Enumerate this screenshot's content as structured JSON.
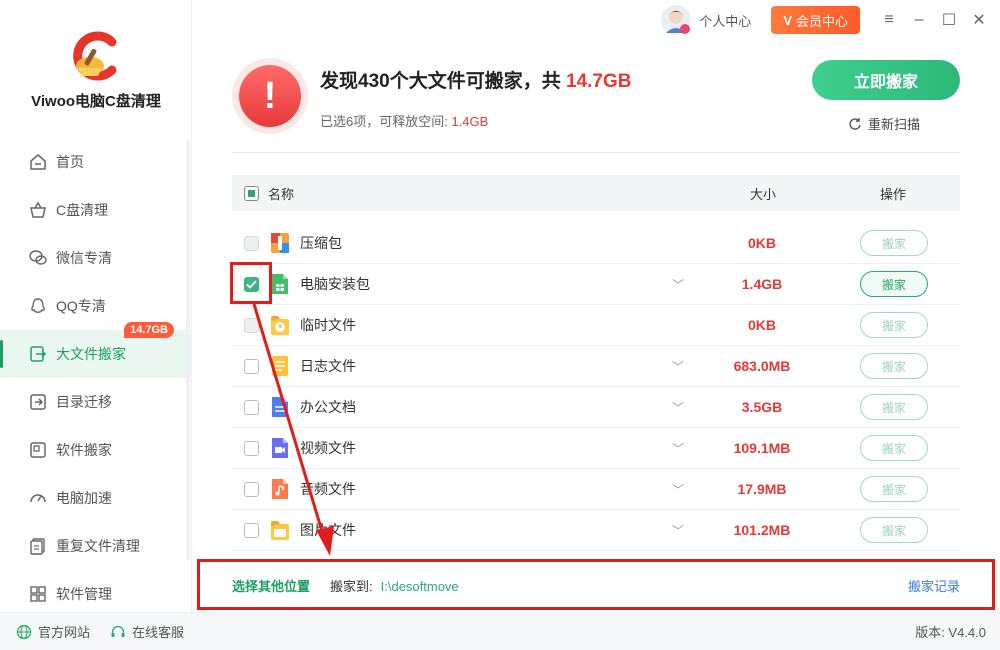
{
  "app": {
    "name": "Viwoo电脑C盘清理"
  },
  "sidebar": {
    "items": [
      {
        "label": "首页",
        "icon": "home-icon",
        "active": false
      },
      {
        "label": "C盘清理",
        "icon": "basket-icon",
        "active": false
      },
      {
        "label": "微信专清",
        "icon": "wechat-icon",
        "active": false
      },
      {
        "label": "QQ专清",
        "icon": "qq-icon",
        "active": false
      },
      {
        "label": "大文件搬家",
        "icon": "move-file-icon",
        "active": true,
        "badge": "14.7GB"
      },
      {
        "label": "目录迁移",
        "icon": "folder-export-icon",
        "active": false
      },
      {
        "label": "软件搬家",
        "icon": "software-move-icon",
        "active": false
      },
      {
        "label": "电脑加速",
        "icon": "speedometer-icon",
        "active": false
      },
      {
        "label": "重复文件清理",
        "icon": "duplicate-file-icon",
        "active": false
      },
      {
        "label": "软件管理",
        "icon": "apps-grid-icon",
        "active": false
      }
    ]
  },
  "topbar": {
    "user_label": "个人中心",
    "vip_label": "会员中心"
  },
  "header": {
    "title_prefix": "发现430个大文件可搬家，共 ",
    "title_size": "14.7GB",
    "sub_prefix": "已选6项，可释放空间: ",
    "sub_size": "1.4GB",
    "move_now": "立即搬家",
    "rescan": "重新扫描"
  },
  "table": {
    "headers": {
      "name": "名称",
      "size": "大小",
      "op": "操作"
    },
    "rows": [
      {
        "name": "压缩包",
        "size": "0KB",
        "op": "搬家",
        "checked": false,
        "disabled": true,
        "expandable": false,
        "icon": "zip-icon"
      },
      {
        "name": "电脑安装包",
        "size": "1.4GB",
        "op": "搬家",
        "checked": true,
        "disabled": false,
        "expandable": true,
        "icon": "installer-icon"
      },
      {
        "name": "临时文件",
        "size": "0KB",
        "op": "搬家",
        "checked": false,
        "disabled": true,
        "expandable": false,
        "icon": "temp-file-icon"
      },
      {
        "name": "日志文件",
        "size": "683.0MB",
        "op": "搬家",
        "checked": false,
        "disabled": false,
        "expandable": true,
        "icon": "log-file-icon"
      },
      {
        "name": "办公文档",
        "size": "3.5GB",
        "op": "搬家",
        "checked": false,
        "disabled": false,
        "expandable": true,
        "icon": "office-doc-icon"
      },
      {
        "name": "视频文件",
        "size": "109.1MB",
        "op": "搬家",
        "checked": false,
        "disabled": false,
        "expandable": true,
        "icon": "video-file-icon"
      },
      {
        "name": "音频文件",
        "size": "17.9MB",
        "op": "搬家",
        "checked": false,
        "disabled": false,
        "expandable": true,
        "icon": "audio-file-icon"
      },
      {
        "name": "图片文件",
        "size": "101.2MB",
        "op": "搬家",
        "checked": false,
        "disabled": false,
        "expandable": true,
        "icon": "image-file-icon"
      }
    ]
  },
  "pathbar": {
    "other_location": "选择其他位置",
    "move_to_label": "搬家到:",
    "move_to_path": "I:\\desoftmove",
    "history": "搬家记录"
  },
  "bottombar": {
    "website": "官方网站",
    "support": "在线客服",
    "version": "版本: V4.4.0"
  },
  "colors": {
    "accent": "#2aa870",
    "danger": "#e53935",
    "vip": "#ff6a33",
    "annotation": "#e21b1b"
  }
}
